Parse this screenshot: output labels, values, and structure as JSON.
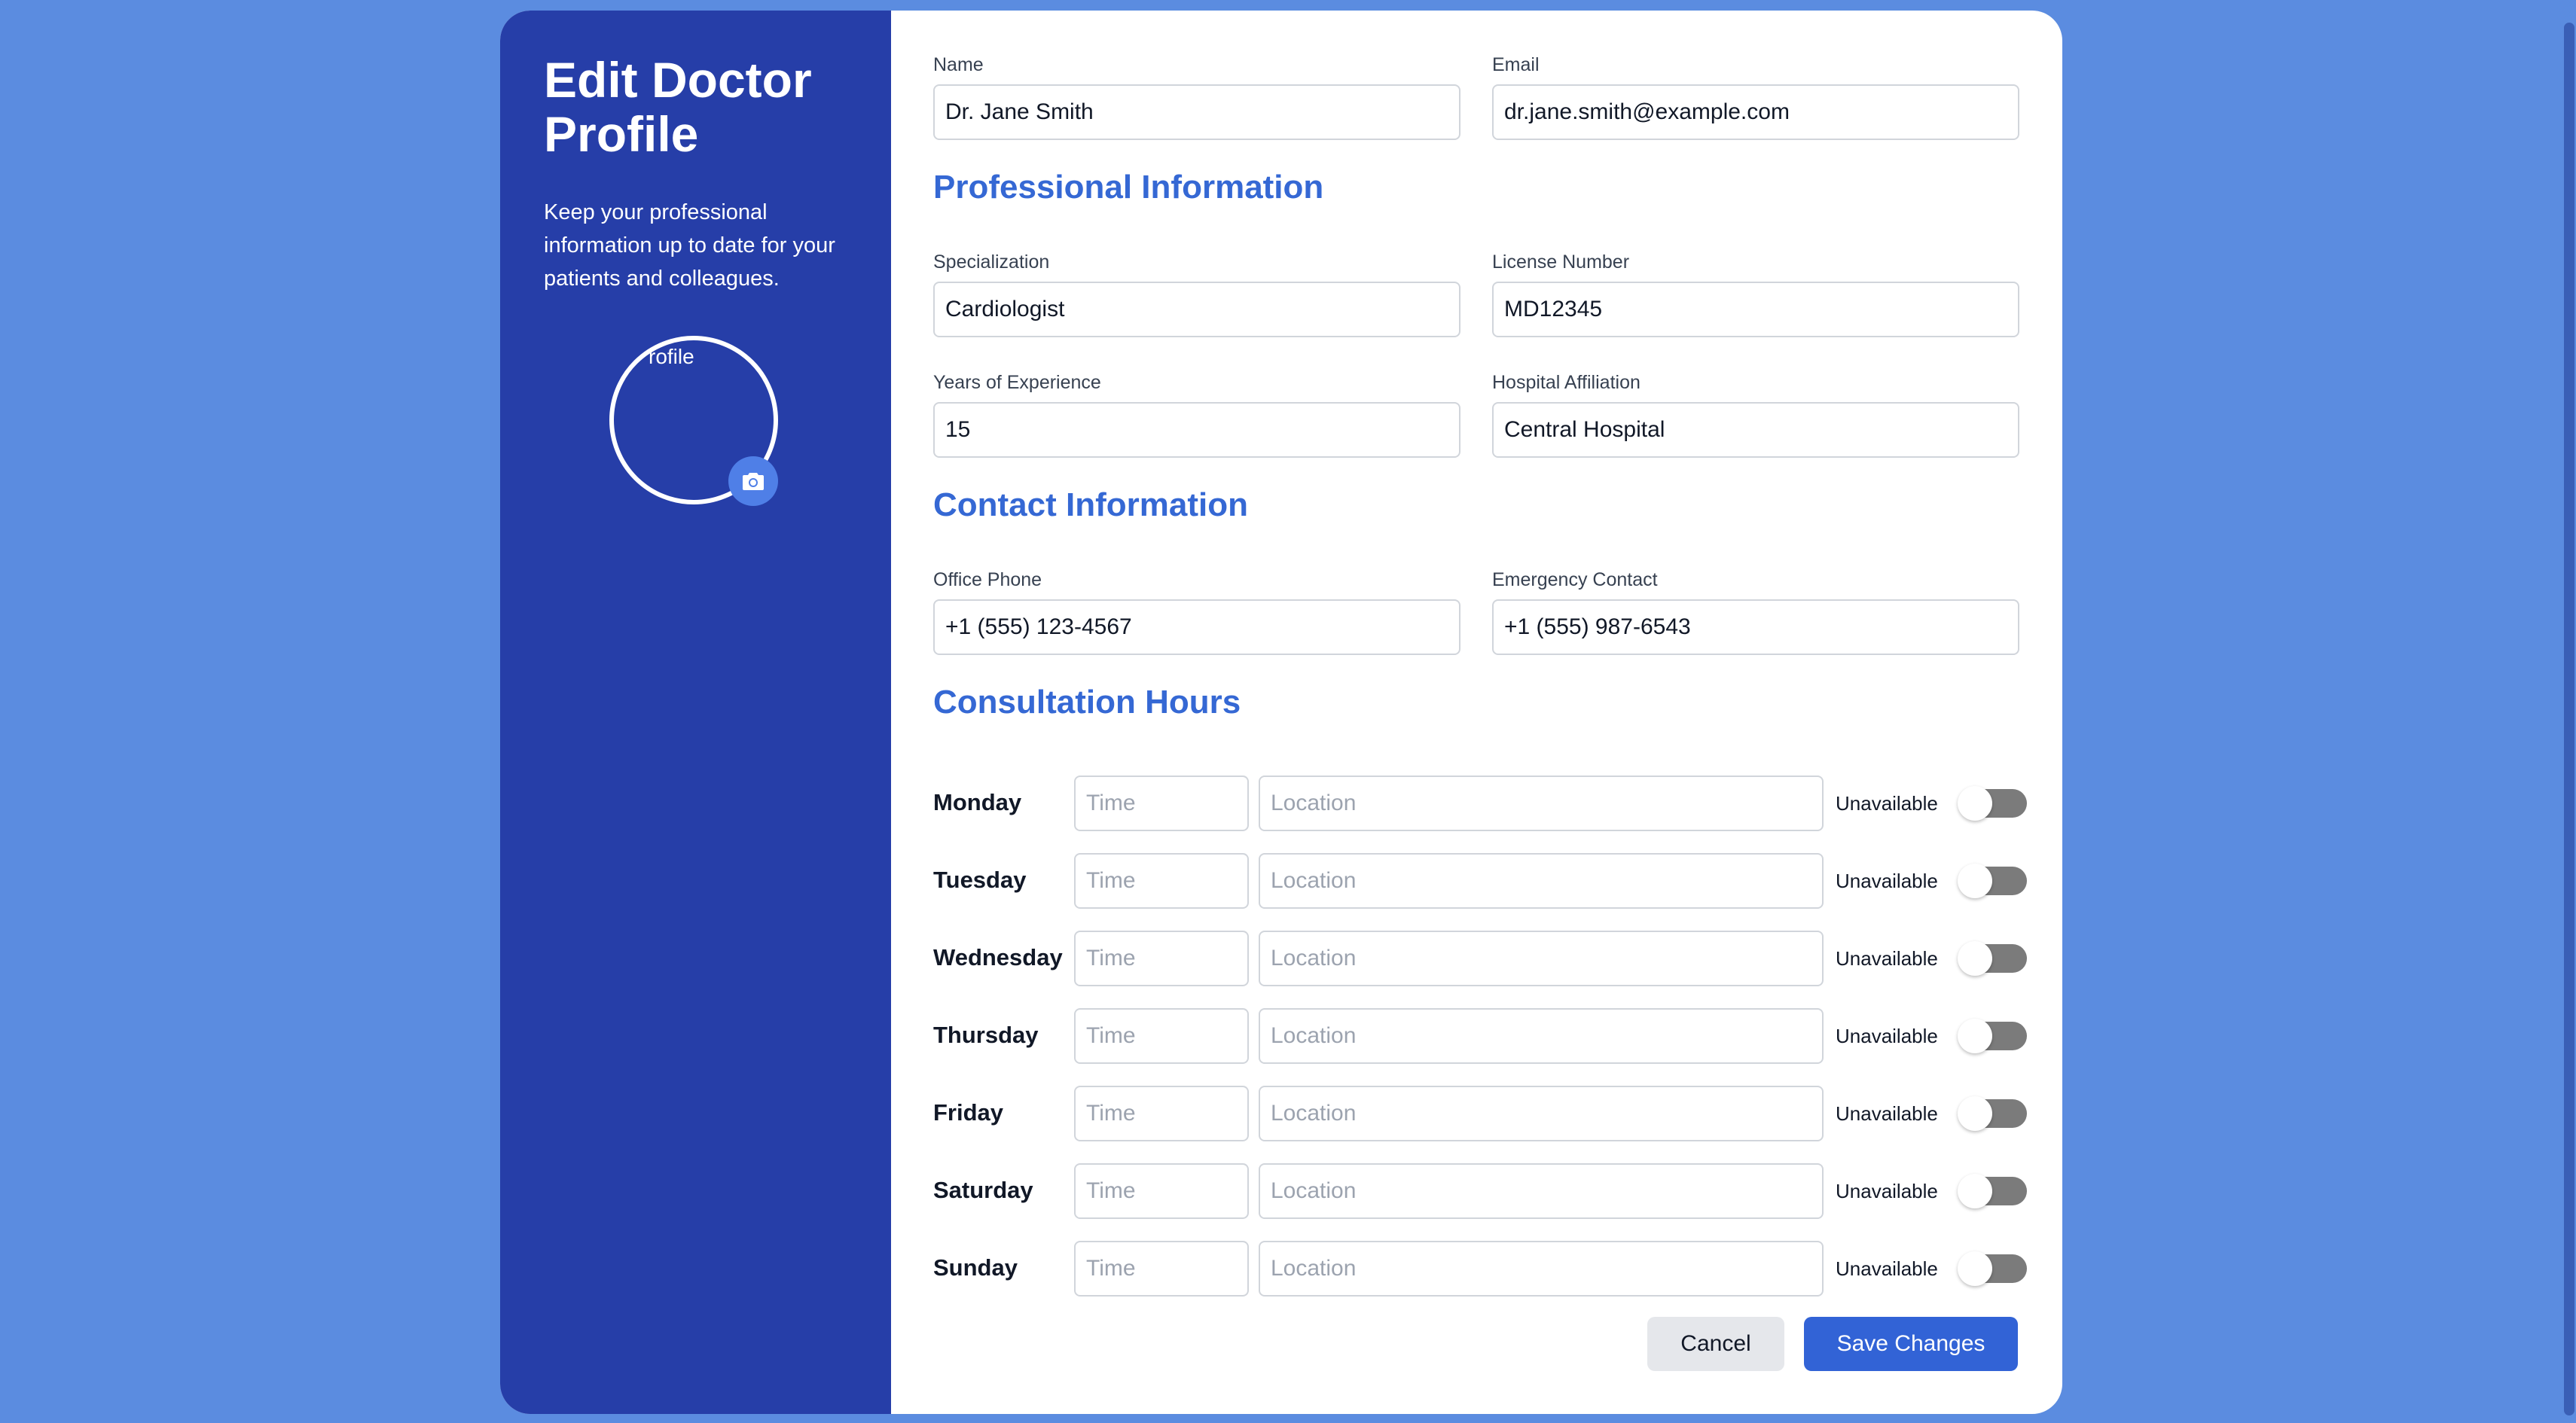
{
  "sidebar": {
    "title": "Edit Doctor Profile",
    "description": "Keep your professional information up to date for your patients and colleagues.",
    "avatar_alt": "rofile"
  },
  "basic": {
    "name_label": "Name",
    "name_value": "Dr. Jane Smith",
    "email_label": "Email",
    "email_value": "dr.jane.smith@example.com"
  },
  "professional": {
    "section_title": "Professional Information",
    "specialization_label": "Specialization",
    "specialization_value": "Cardiologist",
    "license_label": "License Number",
    "license_value": "MD12345",
    "experience_label": "Years of Experience",
    "experience_value": "15",
    "hospital_label": "Hospital Affiliation",
    "hospital_value": "Central Hospital"
  },
  "contact": {
    "section_title": "Contact Information",
    "office_phone_label": "Office Phone",
    "office_phone_value": "+1 (555) 123-4567",
    "emergency_label": "Emergency Contact",
    "emergency_value": "+1 (555) 987-6543"
  },
  "hours": {
    "section_title": "Consultation Hours",
    "time_placeholder": "Time",
    "location_placeholder": "Location",
    "availability_label": "Unavailable",
    "days": [
      {
        "day": "Monday",
        "available": false
      },
      {
        "day": "Tuesday",
        "available": false
      },
      {
        "day": "Wednesday",
        "available": false
      },
      {
        "day": "Thursday",
        "available": false
      },
      {
        "day": "Friday",
        "available": false
      },
      {
        "day": "Saturday",
        "available": false
      },
      {
        "day": "Sunday",
        "available": false
      }
    ]
  },
  "actions": {
    "cancel_label": "Cancel",
    "save_label": "Save Changes"
  },
  "colors": {
    "page_background": "#5b8ce0",
    "sidebar_background": "#263ea8",
    "accent": "#3263d6",
    "section_title": "#3568d4"
  },
  "icons": {
    "avatar_upload": "camera-icon"
  }
}
